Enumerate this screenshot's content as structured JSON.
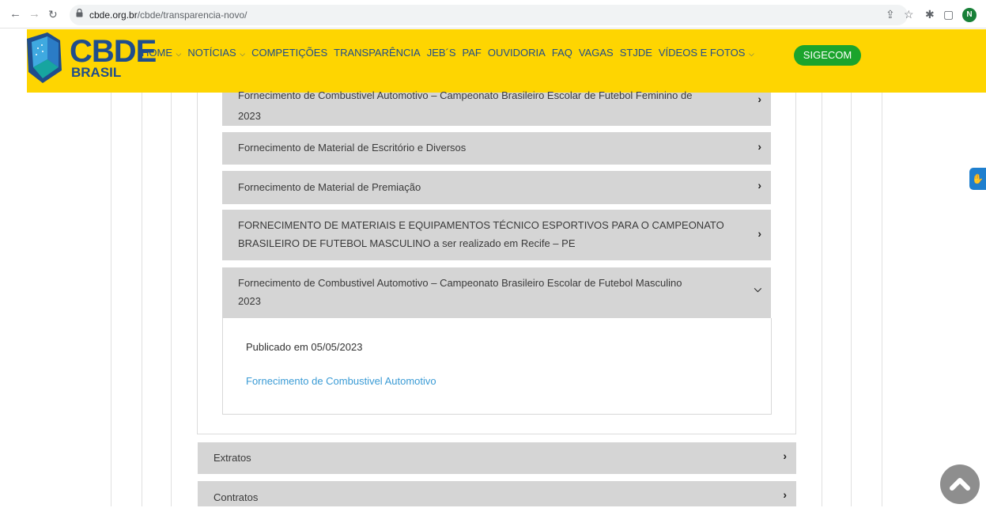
{
  "browser": {
    "url_host": "cbde.org.br",
    "url_path": "/cbde/transparencia-novo/",
    "avatar_letter": "N"
  },
  "header": {
    "logo_text": "CBDE",
    "logo_sub": "BRASIL",
    "menu": [
      {
        "label": "HOME",
        "has_dropdown": true
      },
      {
        "label": "NOTÍCIAS",
        "has_dropdown": true
      },
      {
        "label": "COMPETIÇÕES",
        "has_dropdown": false
      },
      {
        "label": "TRANSPARÊNCIA",
        "has_dropdown": false
      },
      {
        "label": "JEB´S",
        "has_dropdown": false
      },
      {
        "label": "PAF",
        "has_dropdown": false
      },
      {
        "label": "OUVIDORIA",
        "has_dropdown": false
      },
      {
        "label": "FAQ",
        "has_dropdown": false
      },
      {
        "label": "VAGAS",
        "has_dropdown": false
      },
      {
        "label": "STJDE",
        "has_dropdown": false
      },
      {
        "label": "VÍDEOS E FOTOS",
        "has_dropdown": true
      }
    ],
    "sigecom_label": "SIGECOM",
    "colors": {
      "header_bg": "#fed501",
      "brand_blue": "#1f4d8c",
      "sigecom_green": "#1ba42c"
    }
  },
  "accordion": {
    "items": [
      {
        "title_line1": "Fornecimento de Combustivel Automotivo – Campeonato Brasileiro Escolar de Futebol Feminino de",
        "title_line2": "2023",
        "expanded": false
      },
      {
        "title_line1": "Fornecimento de Material de Escritório e Diversos",
        "title_line2": "",
        "expanded": false
      },
      {
        "title_line1": "Fornecimento de Material de Premiação",
        "title_line2": "",
        "expanded": false
      },
      {
        "title_line1": "FORNECIMENTO DE MATERIAIS E EQUIPAMENTOS TÉCNICO ESPORTIVOS PARA O CAMPEONATO",
        "title_line2": "BRASILEIRO DE FUTEBOL MASCULINO a ser realizado em Recife – PE",
        "expanded": false
      },
      {
        "title_line1": "Fornecimento de Combustivel Automotivo – Campeonato Brasileiro Escolar de Futebol Masculino",
        "title_line2": "2023",
        "expanded": true
      }
    ],
    "expanded_panel": {
      "published": "Publicado em 05/05/2023",
      "link_text": "Fornecimento de Combustivel Automotivo"
    }
  },
  "sections": [
    {
      "label": "Extratos"
    },
    {
      "label": "Contratos"
    }
  ]
}
